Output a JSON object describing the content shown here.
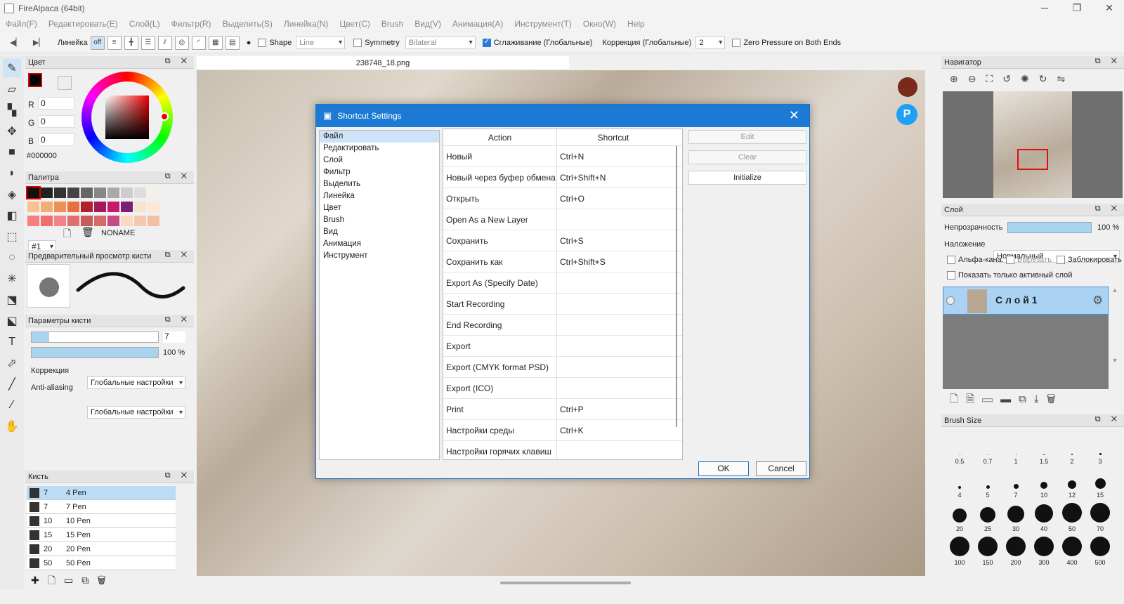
{
  "app": {
    "title": "FireAlpaca (64bit)"
  },
  "menu": [
    "Файл(F)",
    "Редактировать(E)",
    "Слой(L)",
    "Фильтр(R)",
    "Выделить(S)",
    "Линейка(N)",
    "Цвет(C)",
    "Brush",
    "Вид(V)",
    "Анимация(A)",
    "Инструмент(T)",
    "Окно(W)",
    "Help"
  ],
  "toolbar": {
    "ruler_label": "Линейка",
    "off_label": "off",
    "shape_label": "Shape",
    "shape_value": "Line",
    "symmetry_label": "Symmetry",
    "symmetry_value": "Bilateral",
    "smoothing_label": "Сглаживание (Глобальные)",
    "correction_label": "Коррекция (Глобальные)",
    "correction_value": "2",
    "zero_pressure_label": "Zero Pressure on Both Ends"
  },
  "color_panel": {
    "title": "Цвет",
    "r_label": "R",
    "r": "0",
    "g_label": "G",
    "g": "0",
    "b_label": "B",
    "b": "0",
    "hex": "#000000"
  },
  "palette_panel": {
    "title": "Палитра",
    "index": "#1",
    "name": "NONAME"
  },
  "brush_preview_panel": {
    "title": "Предварительный просмотр кисти"
  },
  "brush_params": {
    "title": "Параметры кисти",
    "size_value": "7",
    "opacity_value": "100 %",
    "correction_label": "Коррекция",
    "correction_value": "Глобальные настройки",
    "aa_label": "Anti-aliasing",
    "aa_value": "Глобальные настройки"
  },
  "brush_panel": {
    "title": "Кисть",
    "items": [
      {
        "size": "7",
        "name": "4 Pen"
      },
      {
        "size": "7",
        "name": "7 Pen"
      },
      {
        "size": "10",
        "name": "10 Pen"
      },
      {
        "size": "15",
        "name": "15 Pen"
      },
      {
        "size": "20",
        "name": "20 Pen"
      },
      {
        "size": "50",
        "name": "50 Pen"
      }
    ]
  },
  "canvas": {
    "tab": "238748_18.png"
  },
  "navigator": {
    "title": "Навигатор"
  },
  "layer_panel": {
    "title": "Слой",
    "opacity_label": "Непрозрачность",
    "opacity_value": "100 %",
    "blend_label": "Наложение",
    "blend_value": "Нормальный",
    "alpha_label": "Альфа-кана.",
    "clip_label": "Вырезать",
    "lock_label": "Заблокировать",
    "show_active_label": "Показать только активный слой",
    "layer_name": "С л о й 1"
  },
  "brush_size_panel": {
    "title": "Brush Size",
    "sizes": [
      "0.5",
      "0.7",
      "1",
      "1.5",
      "2",
      "3",
      "4",
      "5",
      "7",
      "10",
      "12",
      "15",
      "20",
      "25",
      "30",
      "40",
      "50",
      "70",
      "100",
      "150",
      "200",
      "300",
      "400",
      "500"
    ]
  },
  "dialog": {
    "title": "Shortcut Settings",
    "categories": [
      "Файл",
      "Редактировать",
      "Слой",
      "Фильтр",
      "Выделить",
      "Линейка",
      "Цвет",
      "Brush",
      "Вид",
      "Анимация",
      "Инструмент"
    ],
    "col_action": "Action",
    "col_shortcut": "Shortcut",
    "rows": [
      {
        "action": "Новый",
        "shortcut": "Ctrl+N"
      },
      {
        "action": "Новый через буфер обмена",
        "shortcut": "Ctrl+Shift+N"
      },
      {
        "action": "Открыть",
        "shortcut": "Ctrl+O"
      },
      {
        "action": "Open As a New Layer",
        "shortcut": ""
      },
      {
        "action": "Сохранить",
        "shortcut": "Ctrl+S"
      },
      {
        "action": "Сохранить как",
        "shortcut": "Ctrl+Shift+S"
      },
      {
        "action": "Export As (Specify Date)",
        "shortcut": ""
      },
      {
        "action": "Start Recording",
        "shortcut": ""
      },
      {
        "action": "End Recording",
        "shortcut": ""
      },
      {
        "action": "Export",
        "shortcut": ""
      },
      {
        "action": "Export (CMYK format PSD)",
        "shortcut": ""
      },
      {
        "action": "Export (ICO)",
        "shortcut": ""
      },
      {
        "action": "Print",
        "shortcut": "Ctrl+P"
      },
      {
        "action": "Настройки среды",
        "shortcut": "Ctrl+K"
      },
      {
        "action": "Настройки горячих клавиш",
        "shortcut": ""
      }
    ],
    "edit_label": "Edit",
    "clear_label": "Clear",
    "init_label": "Initialize",
    "ok_label": "OK",
    "cancel_label": "Cancel"
  }
}
